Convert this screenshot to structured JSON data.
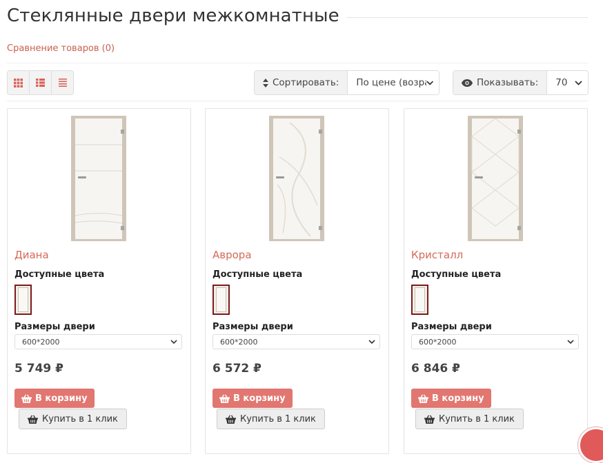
{
  "page": {
    "title": "Стеклянные двери межкомнатные"
  },
  "compare": {
    "label": "Сравнение товаров (0)"
  },
  "view_modes": [
    "grid-icon",
    "list-icon",
    "compact-list-icon"
  ],
  "sort": {
    "label": "Сортировать:",
    "value": "По цене (возра"
  },
  "show": {
    "label": "Показывать:",
    "value": "70"
  },
  "products": [
    {
      "name": "Диана",
      "colors_label": "Доступные цвета",
      "sizes_label": "Размеры двери",
      "size": "600*2000",
      "price": "5 749 ₽",
      "cart_label": "В корзину",
      "oneclick_label": "Купить в 1 клик"
    },
    {
      "name": "Аврора",
      "colors_label": "Доступные цвета",
      "sizes_label": "Размеры двери",
      "size": "600*2000",
      "price": "6 572 ₽",
      "cart_label": "В корзину",
      "oneclick_label": "Купить в 1 клик"
    },
    {
      "name": "Кристалл",
      "colors_label": "Доступные цвета",
      "sizes_label": "Размеры двери",
      "size": "600*2000",
      "price": "6 846 ₽",
      "cart_label": "В корзину",
      "oneclick_label": "Купить в 1 клик"
    }
  ],
  "colors": {
    "accent": "#e27670",
    "link": "#c9604f",
    "name": "#d46a57",
    "swatch_border": "#7a1a1a"
  }
}
